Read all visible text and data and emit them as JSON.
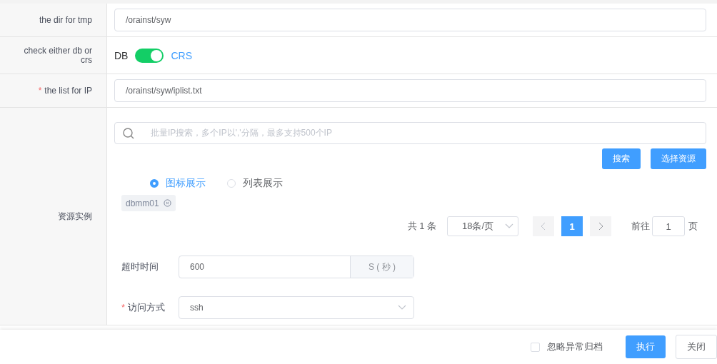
{
  "form_rows": [
    {
      "kind": "text",
      "label": "the dir for tmp",
      "value": "/orainst/syw"
    },
    {
      "kind": "switch",
      "label": "check either db or crs",
      "off_label": "DB",
      "on_label": "CRS",
      "on": true
    },
    {
      "kind": "text",
      "label": "the list for IP",
      "required_mark": "*",
      "value": "/orainst/syw/iplist.txt"
    },
    {
      "kind": "resources",
      "label": "资源实例"
    }
  ],
  "resources": {
    "search": {
      "placeholder": "批量IP搜索，多个IP以','分隔，最多支持500个IP"
    },
    "buttons": [
      {
        "label": "搜索"
      },
      {
        "label": "选择资源"
      }
    ],
    "view_options": [
      {
        "label": "图标展示",
        "selected": true
      },
      {
        "label": "列表展示",
        "selected": false
      }
    ],
    "tags": [
      {
        "label": "dbmm01"
      }
    ],
    "pagination": {
      "total": "共 1 条",
      "page_size": "18条/页",
      "pages": [
        {
          "label": "1",
          "selected": true
        }
      ],
      "goto_label": "前往",
      "goto_value": "1",
      "page_suffix": "页"
    },
    "timeout": {
      "label": "超时时间",
      "value": "600",
      "unit": "S ( 秒 )"
    },
    "access": {
      "label": "访问方式",
      "required_mark": "*",
      "value": "ssh"
    }
  },
  "footer": {
    "checkbox": {
      "label": "忽略异常归档",
      "checked": false
    },
    "buttons": [
      {
        "label": "执行",
        "kind": "primary"
      },
      {
        "label": "关闭",
        "kind": "default"
      }
    ]
  }
}
